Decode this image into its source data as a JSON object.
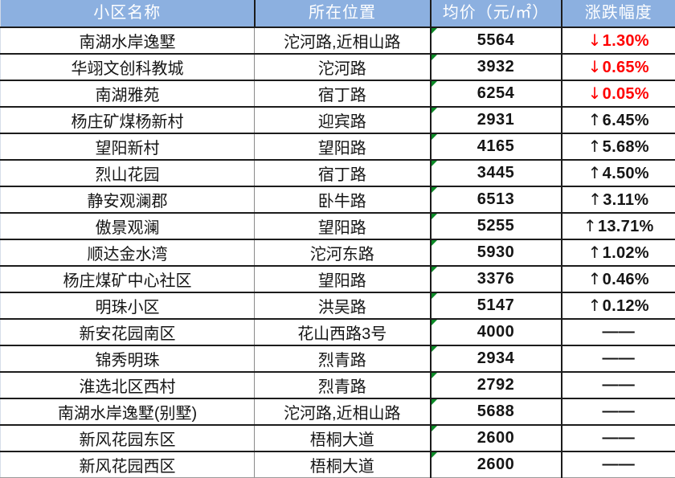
{
  "table": {
    "columns": [
      {
        "key": "name",
        "label": "小区名称"
      },
      {
        "key": "loc",
        "label": "所在位置"
      },
      {
        "key": "price",
        "label": "均价（元/㎡）"
      },
      {
        "key": "change",
        "label": "涨跌幅度"
      }
    ],
    "header_bg": "#8cb0e0",
    "header_text_color": "#ffffff",
    "down_color": "#ff0000",
    "up_color": "#151515",
    "flag_color": "#0b8a26",
    "rows": [
      {
        "name": "南湖水岸逸墅",
        "loc": "沱河路,近相山路",
        "price": "5564",
        "dir": "down",
        "change": "1.30%",
        "arrow": "↓"
      },
      {
        "name": "华翊文创科教城",
        "loc": "沱河路",
        "price": "3932",
        "dir": "down",
        "change": "0.65%",
        "arrow": "↓"
      },
      {
        "name": "南湖雅苑",
        "loc": "宿丁路",
        "price": "6254",
        "dir": "down",
        "change": "0.05%",
        "arrow": "↓"
      },
      {
        "name": "杨庄矿煤杨新村",
        "loc": "迎宾路",
        "price": "2931",
        "dir": "up",
        "change": "6.45%",
        "arrow": "↑"
      },
      {
        "name": "望阳新村",
        "loc": "望阳路",
        "price": "4165",
        "dir": "up",
        "change": "5.68%",
        "arrow": "↑"
      },
      {
        "name": "烈山花园",
        "loc": "宿丁路",
        "price": "3445",
        "dir": "up",
        "change": "4.50%",
        "arrow": "↑"
      },
      {
        "name": "静安观澜郡",
        "loc": "卧牛路",
        "price": "6513",
        "dir": "up",
        "change": "3.11%",
        "arrow": "↑"
      },
      {
        "name": "傲景观澜",
        "loc": "望阳路",
        "price": "5255",
        "dir": "up",
        "change": "13.71%",
        "arrow": "↑"
      },
      {
        "name": "顺达金水湾",
        "loc": "沱河东路",
        "price": "5930",
        "dir": "up",
        "change": "1.02%",
        "arrow": "↑"
      },
      {
        "name": "杨庄煤矿中心社区",
        "loc": "望阳路",
        "price": "3376",
        "dir": "up",
        "change": "0.46%",
        "arrow": "↑"
      },
      {
        "name": "明珠小区",
        "loc": "洪吴路",
        "price": "5147",
        "dir": "up",
        "change": "0.12%",
        "arrow": "↑"
      },
      {
        "name": "新安花园南区",
        "loc": "花山西路3号",
        "price": "4000",
        "dir": "none",
        "change": "——",
        "arrow": ""
      },
      {
        "name": "锦秀明珠",
        "loc": "烈青路",
        "price": "2934",
        "dir": "none",
        "change": "——",
        "arrow": ""
      },
      {
        "name": "淮选北区西村",
        "loc": "烈青路",
        "price": "2792",
        "dir": "none",
        "change": "——",
        "arrow": ""
      },
      {
        "name": "南湖水岸逸墅(别墅)",
        "loc": "沱河路,近相山路",
        "price": "5688",
        "dir": "none",
        "change": "——",
        "arrow": ""
      },
      {
        "name": "新风花园东区",
        "loc": "梧桐大道",
        "price": "2600",
        "dir": "none",
        "change": "——",
        "arrow": ""
      },
      {
        "name": "新风花园西区",
        "loc": "梧桐大道",
        "price": "2600",
        "dir": "none",
        "change": "——",
        "arrow": ""
      }
    ]
  }
}
